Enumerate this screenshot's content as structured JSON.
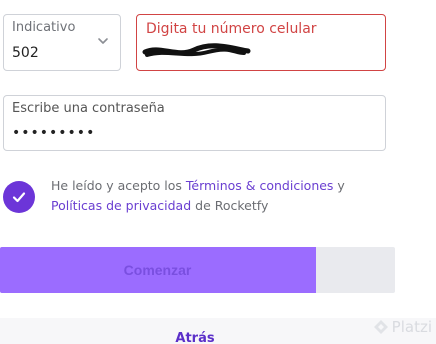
{
  "country_code": {
    "label": "Indicativo",
    "value": "502"
  },
  "phone": {
    "label": "Digita tu número celular"
  },
  "password": {
    "label": "Escribe una contraseña",
    "value": "•••••••••"
  },
  "terms": {
    "checked": true,
    "prefix": "He leído y acepto los ",
    "terms_link": "Términos & condiciones",
    "connector": " y ",
    "privacy_link": "Políticas de privacidad",
    "suffix": " de Rocketfy"
  },
  "start_button": {
    "label": "Comenzar",
    "progress": 0.8
  },
  "back_link": {
    "label": "Atrás"
  },
  "watermark": {
    "text": "Platzi"
  },
  "colors": {
    "accent": "#6c35d8",
    "button_fill": "#9b6cff",
    "error": "#d14444"
  }
}
